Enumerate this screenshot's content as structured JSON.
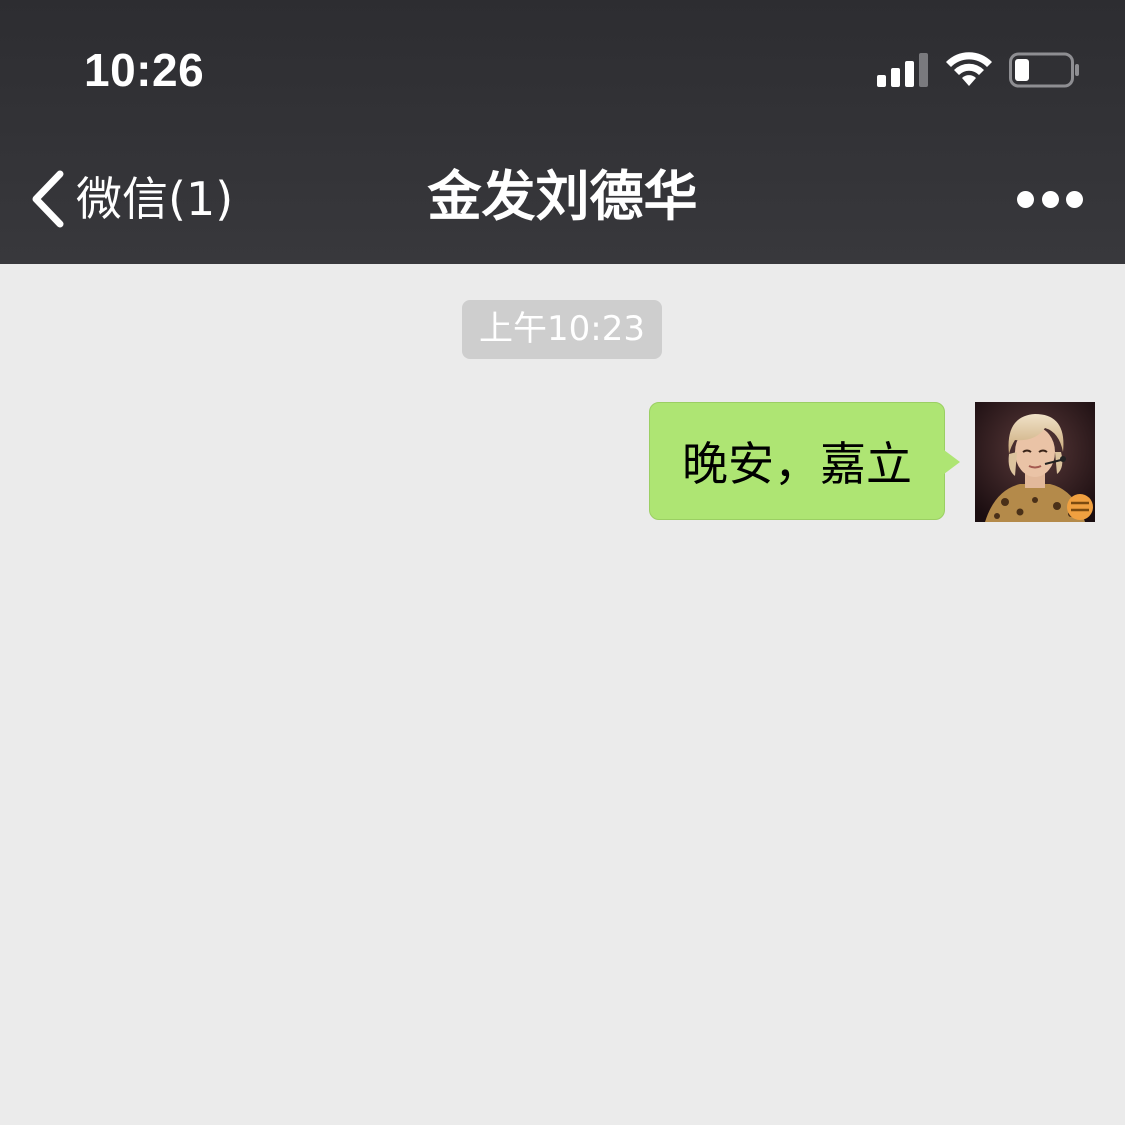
{
  "status_bar": {
    "time": "10:26"
  },
  "nav": {
    "back_label": "微信(1)",
    "title": "金发刘德华"
  },
  "chat": {
    "timestamp": "上午10:23",
    "messages": [
      {
        "sender": "self",
        "text": "晚安，嘉立"
      }
    ]
  },
  "colors": {
    "header_bg": "#333336",
    "chat_bg": "#ebebeb",
    "bubble_self": "#aee573",
    "timestamp_bg": "#cecece"
  },
  "icons": [
    "signal-icon",
    "wifi-icon",
    "battery-icon",
    "back-chevron-icon",
    "more-icon"
  ]
}
